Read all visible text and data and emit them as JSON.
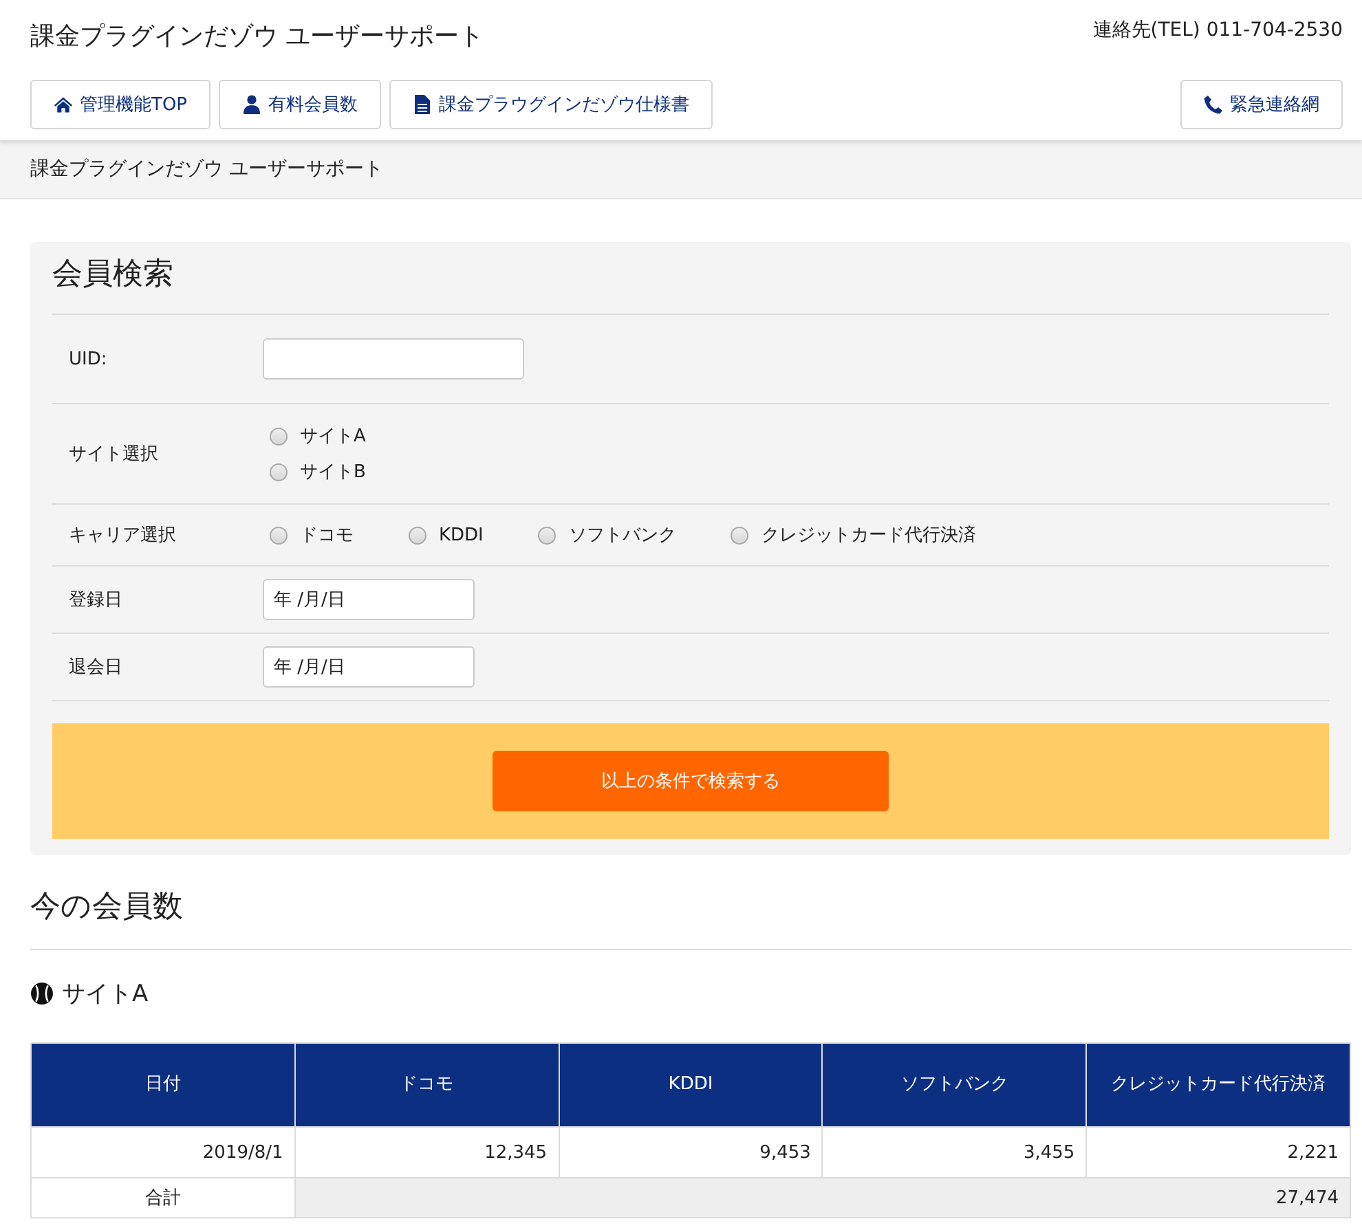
{
  "header": {
    "title": "課金プラグインだゾウ ユーザーサポート",
    "contact": "連絡先(TEL) 011-704-2530"
  },
  "nav": [
    {
      "label": "管理機能TOP"
    },
    {
      "label": "有料会員数"
    },
    {
      "label": "課金プラウグインだゾウ仕様書"
    }
  ],
  "emergency": {
    "label": "緊急連絡網"
  },
  "breadcrumb": "課金プラグインだゾウ ユーザーサポート",
  "search": {
    "title": "会員検索",
    "rows": [
      {
        "kind": "text",
        "label": "UID:"
      },
      {
        "kind": "radio_stack",
        "label": "サイト選択",
        "options": [
          {
            "label": "サイトA",
            "selected": false
          },
          {
            "label": "サイトB",
            "selected": false
          }
        ]
      },
      {
        "kind": "radio_inline",
        "label": "キャリア選択",
        "options": [
          {
            "label": "ドコモ",
            "selected": false
          },
          {
            "label": "KDDI",
            "selected": false
          },
          {
            "label": "ソフトバンク",
            "selected": false
          },
          {
            "label": "クレジットカード代行決済",
            "selected": false
          }
        ]
      },
      {
        "kind": "date",
        "label": "登録日",
        "placeholder": "年 /月/日"
      },
      {
        "kind": "date",
        "label": "退会日",
        "placeholder": "年 /月/日"
      }
    ],
    "button": "以上の条件で検索する"
  },
  "members": {
    "title": "今の会員数",
    "site": "サイトA",
    "table": {
      "columns": [
        "日付",
        "ドコモ",
        "KDDI",
        "ソフトバンク",
        "クレジットカード代行決済"
      ],
      "rows": [
        [
          "2019/8/1",
          "12,345",
          "9,453",
          "3,455",
          "2,221"
        ]
      ],
      "total": {
        "label": "合計",
        "value": "27,474"
      }
    }
  }
}
